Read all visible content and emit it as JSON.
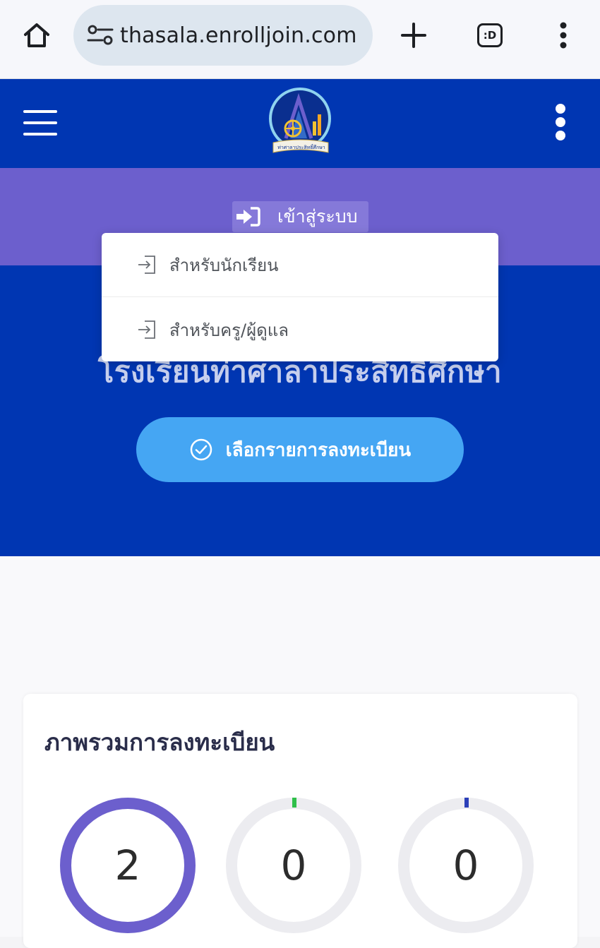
{
  "browser": {
    "url": "thasala.enrolljoin.com",
    "home_icon": "home-icon",
    "site_info_icon": "tune-icon",
    "new_tab_icon": "plus-icon",
    "tabs_icon": "tab-switcher-icon",
    "tabs_label": ":D",
    "menu_icon": "kebab-menu-icon"
  },
  "header": {
    "logo_text": "ท่าศาลาประสิทธิ์ศึกษา",
    "menu_icon": "hamburger-icon",
    "more_icon": "kebab-menu-icon"
  },
  "login": {
    "label": "เข้าสู่ระบบ",
    "icon": "sign-in-icon"
  },
  "dropdown": {
    "items": [
      {
        "label": "สำหรับนักเรียน",
        "icon": "sign-in-icon"
      },
      {
        "label": "สำหรับครู/ผู้ดูแล",
        "icon": "sign-in-icon"
      }
    ]
  },
  "hero": {
    "title": "โรงเรียนท่าศาลาประสิทธิ์ศึกษา",
    "cta_label": "เลือกรายการลงทะเบียน",
    "cta_icon": "check-circle-icon"
  },
  "overview": {
    "title": "ภาพรวมการลงทะเบียน",
    "stats": [
      {
        "value": "2",
        "color": "#6c5fcd"
      },
      {
        "value": "0",
        "color": "#2fbf4a"
      },
      {
        "value": "0",
        "color": "#2b3fb8"
      }
    ]
  },
  "colors": {
    "header_blue": "#0036b2",
    "purple": "#6c5fcd",
    "cta_blue": "#45a6f3"
  }
}
